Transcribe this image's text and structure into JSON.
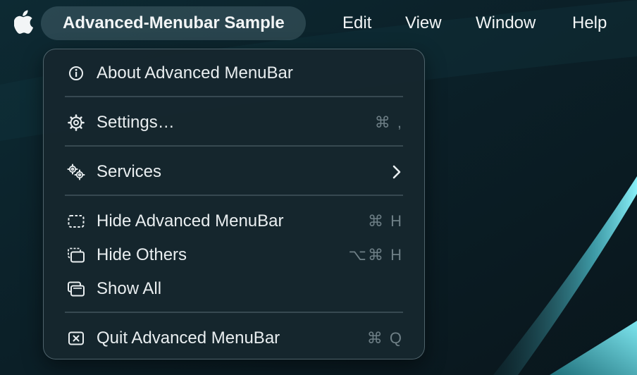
{
  "menubar": {
    "apple_icon": "apple-logo-icon",
    "app_name": "Advanced-Menubar Sample",
    "items": [
      {
        "label": "Edit"
      },
      {
        "label": "View"
      },
      {
        "label": "Window"
      },
      {
        "label": "Help"
      }
    ]
  },
  "dropdown": {
    "items": [
      {
        "label": "About Advanced MenuBar",
        "icon": "info-circle-icon",
        "shortcut": ""
      },
      {
        "label": "Settings…",
        "icon": "gear-icon",
        "shortcut": "⌘ ,"
      },
      {
        "label": "Services",
        "icon": "gears-icon",
        "shortcut": "",
        "submenu": true
      },
      {
        "label": "Hide Advanced MenuBar",
        "icon": "dashed-window-icon",
        "shortcut": "⌘ H"
      },
      {
        "label": "Hide Others",
        "icon": "stacked-dashed-windows-icon",
        "shortcut": "⌥⌘ H"
      },
      {
        "label": "Show All",
        "icon": "stacked-windows-icon",
        "shortcut": ""
      },
      {
        "label": "Quit Advanced MenuBar",
        "icon": "close-box-icon",
        "shortcut": "⌘ Q"
      }
    ]
  },
  "colors": {
    "wallpaper_dark": "#0b1e26",
    "wallpaper_accent": "#6fe0ec",
    "menu_background": "#16262e",
    "text": "#e9eef0",
    "shortcut_text": "#6e7f86"
  }
}
